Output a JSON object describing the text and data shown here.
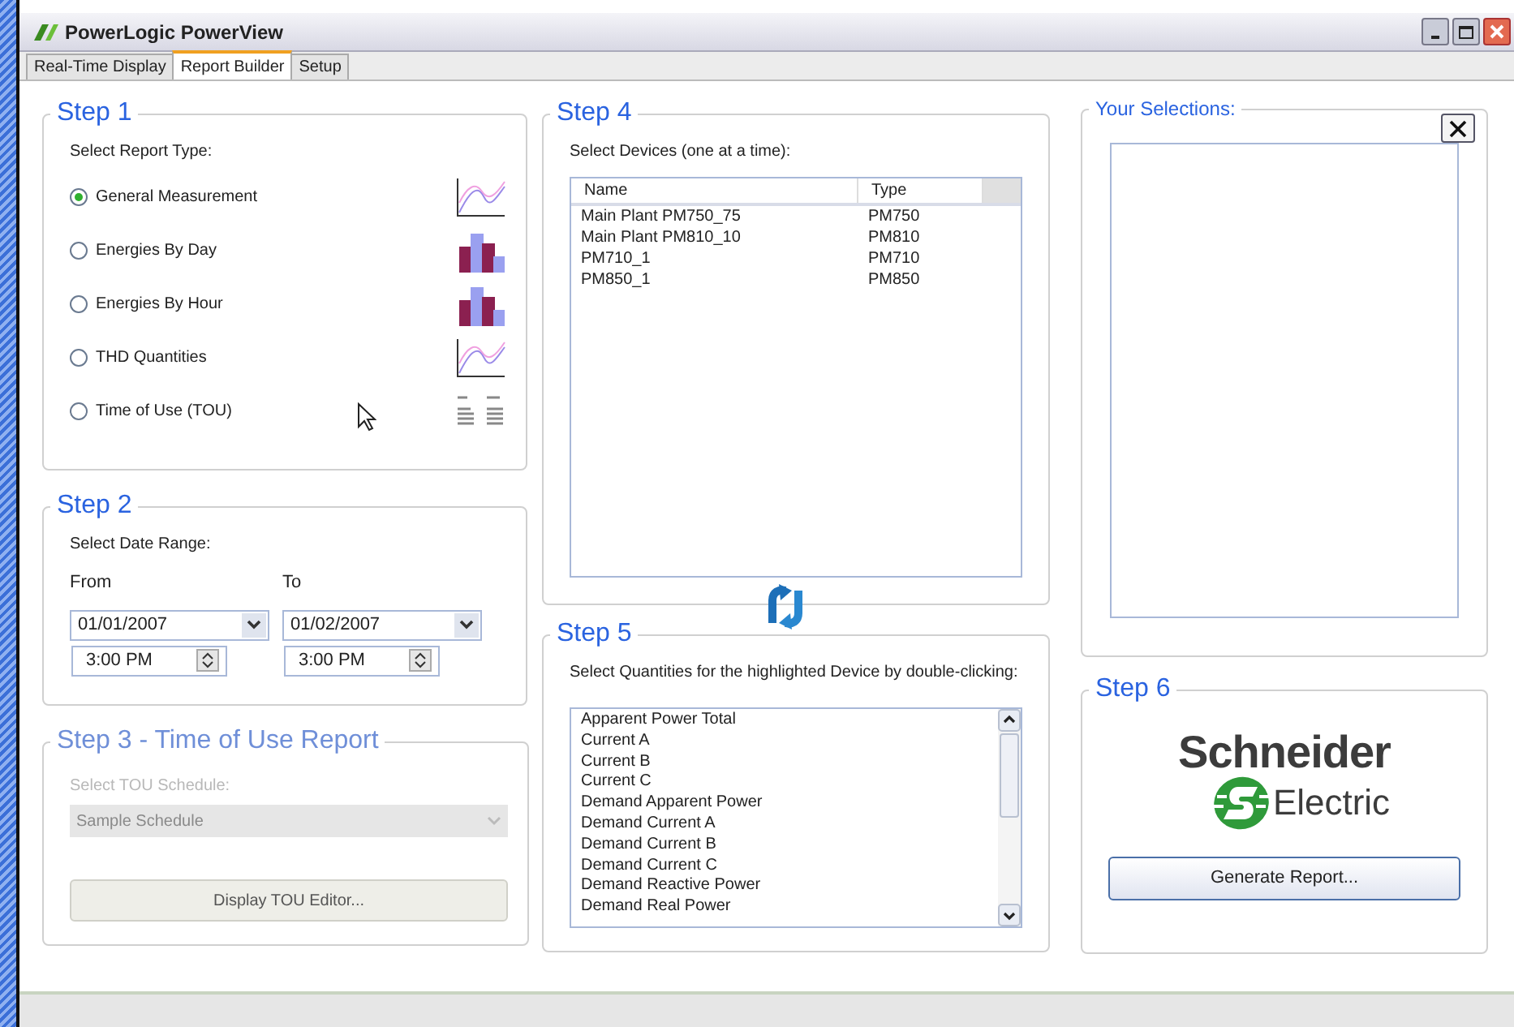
{
  "window": {
    "title": "PowerLogic PowerView"
  },
  "tabs": [
    {
      "label": "Real-Time Display",
      "selected": false
    },
    {
      "label": "Report Builder",
      "selected": true
    },
    {
      "label": "Setup",
      "selected": false
    }
  ],
  "step1": {
    "title": "Step 1",
    "label": "Select Report Type:",
    "options": [
      {
        "label": "General Measurement",
        "selected": true,
        "kind": "line"
      },
      {
        "label": "Energies By Day",
        "selected": false,
        "kind": "bar"
      },
      {
        "label": "Energies By Hour",
        "selected": false,
        "kind": "bar"
      },
      {
        "label": "THD Quantities",
        "selected": false,
        "kind": "line"
      },
      {
        "label": "Time of Use (TOU)",
        "selected": false,
        "kind": "table"
      }
    ]
  },
  "step2": {
    "title": "Step 2",
    "label": "Select Date Range:",
    "from": {
      "label": "From",
      "date": "01/01/2007",
      "time": "3:00 PM"
    },
    "to": {
      "label": "To",
      "date": "01/02/2007",
      "time": "3:00 PM"
    }
  },
  "step3": {
    "title": "Step 3 - Time of Use Report",
    "disabled": true,
    "label": "Select TOU Schedule:",
    "schedule": "Sample Schedule",
    "button": "Display TOU Editor..."
  },
  "step4": {
    "title": "Step 4",
    "label": "Select Devices (one at a time):",
    "columns": [
      "Name",
      "Type"
    ],
    "rows": [
      [
        "Main Plant PM750_75",
        "PM750"
      ],
      [
        "Main Plant PM810_10",
        "PM810"
      ],
      [
        "PM710_1",
        "PM710"
      ],
      [
        "PM850_1",
        "PM850"
      ]
    ]
  },
  "step5": {
    "title": "Step 5",
    "label": "Select Quantities for the highlighted Device by double-clicking:",
    "items": [
      "Apparent Power Total",
      "Current A",
      "Current B",
      "Current C",
      "Demand Apparent Power",
      "Demand Current A",
      "Demand Current B",
      "Demand Current C",
      "Demand Reactive Power",
      "Demand Real Power"
    ]
  },
  "selections": {
    "title": "Your Selections:"
  },
  "step6": {
    "title": "Step 6",
    "logo": {
      "name": "Schneider",
      "sub": "Electric"
    },
    "button": "Generate Report..."
  }
}
